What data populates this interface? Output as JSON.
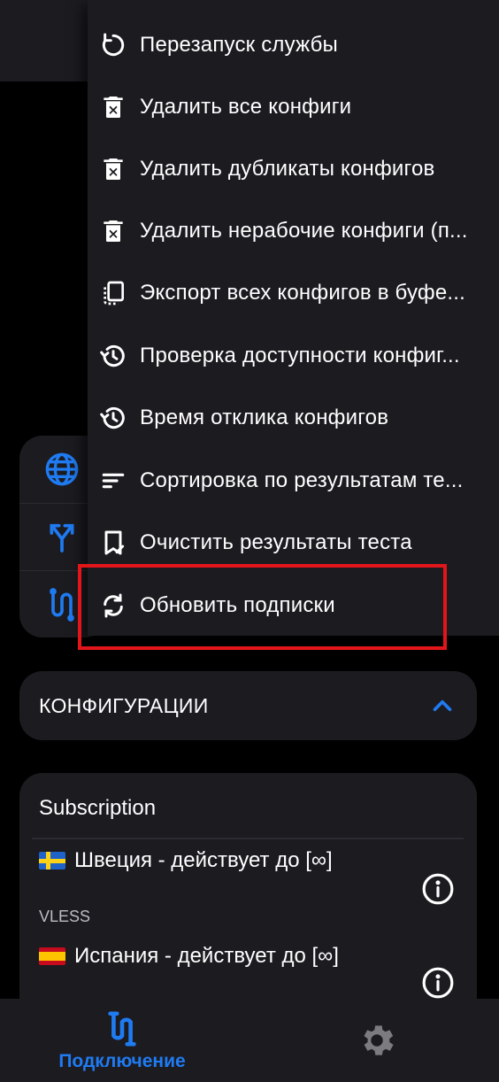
{
  "menu": {
    "items": [
      {
        "label": "Перезапуск службы",
        "icon": "restart-icon"
      },
      {
        "label": "Удалить все конфиги",
        "icon": "delete-icon"
      },
      {
        "label": "Удалить дубликаты конфигов",
        "icon": "delete-icon"
      },
      {
        "label": "Удалить нерабочие конфиги (п...",
        "icon": "delete-icon"
      },
      {
        "label": "Экспорт всех конфигов в буфе...",
        "icon": "clipboard-icon"
      },
      {
        "label": "Проверка доступности конфиг...",
        "icon": "history-icon"
      },
      {
        "label": "Время отклика конфигов",
        "icon": "history-icon"
      },
      {
        "label": "Сортировка по результатам те...",
        "icon": "sort-icon"
      },
      {
        "label": "Очистить результаты теста",
        "icon": "bookmark-remove-icon"
      },
      {
        "label": "Обновить подписки",
        "icon": "sync-icon"
      }
    ],
    "highlighted_item": "Обновить подписки"
  },
  "quick_actions": [
    {
      "icon": "globe-icon"
    },
    {
      "icon": "split-route-icon"
    },
    {
      "icon": "routing-icon"
    }
  ],
  "configs_section": {
    "title": "КОНФИГУРАЦИИ",
    "expanded": true
  },
  "subscription": {
    "title": "Subscription",
    "servers": [
      {
        "flag": "sweden",
        "name": "Швеция - действует до [∞]",
        "protocol": ""
      },
      {
        "flag": "spain",
        "name": "Испания - действует до [∞]",
        "protocol": "VLESS"
      }
    ]
  },
  "bottom_nav": {
    "connect_label": "Подключение",
    "active": "connect"
  },
  "colors": {
    "accent": "#1f7bf2",
    "surface": "#1c1b20",
    "background": "#000000",
    "highlight": "#e2161a"
  }
}
